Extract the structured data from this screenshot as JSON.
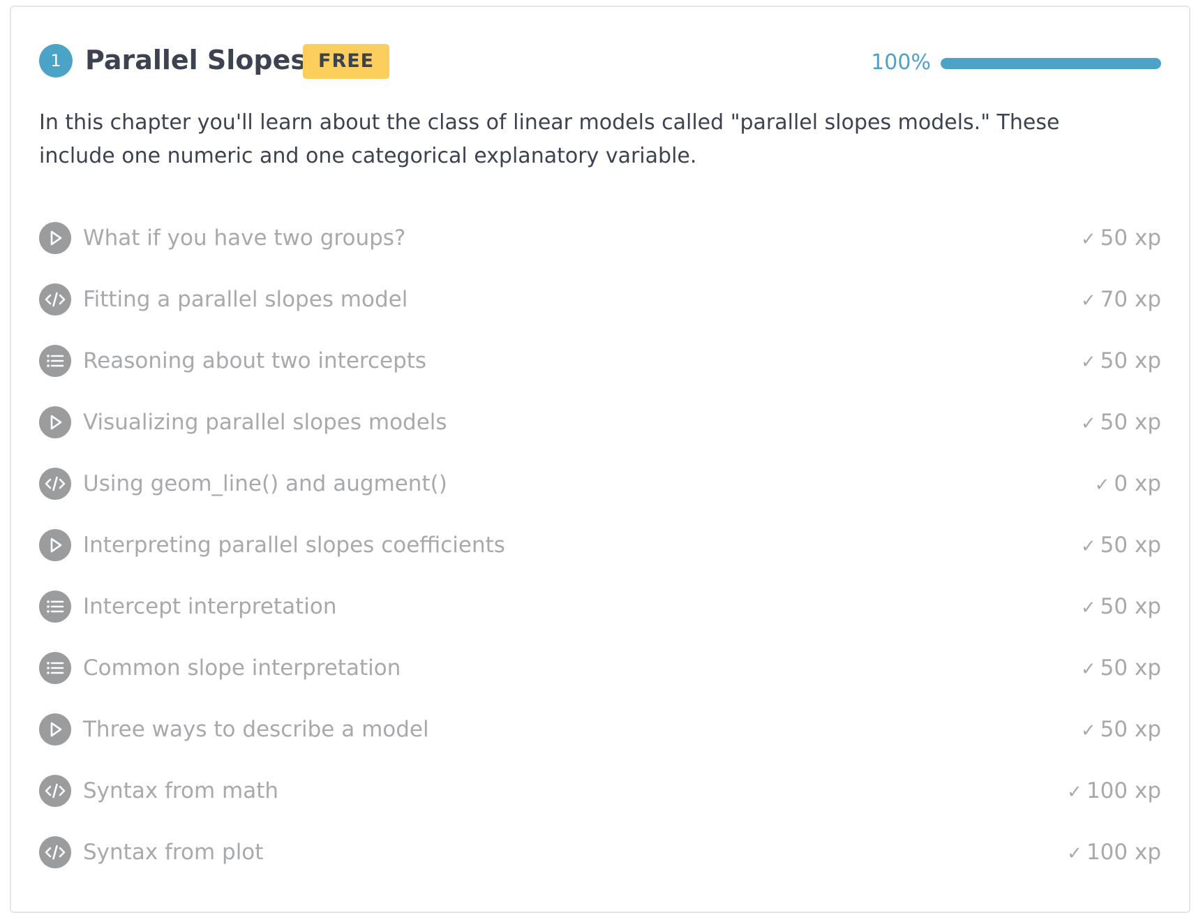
{
  "chapter": {
    "number": "1",
    "title": "Parallel Slopes",
    "badge": "FREE",
    "progress_label": "100%",
    "progress_fraction": 1.0,
    "description": "In this chapter you'll learn about the class of linear models called \"parallel slopes models.\" These include one numeric and one categorical explanatory variable."
  },
  "lessons": [
    {
      "icon": "play-icon",
      "title": "What if you have two groups?",
      "xp": "50 xp"
    },
    {
      "icon": "code-icon",
      "title": "Fitting a parallel slopes model",
      "xp": "70 xp"
    },
    {
      "icon": "list-icon",
      "title": "Reasoning about two intercepts",
      "xp": "50 xp"
    },
    {
      "icon": "play-icon",
      "title": "Visualizing parallel slopes models",
      "xp": "50 xp"
    },
    {
      "icon": "code-icon",
      "title": "Using geom_line() and augment()",
      "xp": "0 xp"
    },
    {
      "icon": "play-icon",
      "title": "Interpreting parallel slopes coefficients",
      "xp": "50 xp"
    },
    {
      "icon": "list-icon",
      "title": "Intercept interpretation",
      "xp": "50 xp"
    },
    {
      "icon": "list-icon",
      "title": "Common slope interpretation",
      "xp": "50 xp"
    },
    {
      "icon": "play-icon",
      "title": "Three ways to describe a model",
      "xp": "50 xp"
    },
    {
      "icon": "code-icon",
      "title": "Syntax from math",
      "xp": "100 xp"
    },
    {
      "icon": "code-icon",
      "title": "Syntax from plot",
      "xp": "100 xp"
    }
  ],
  "check_glyph": "✓",
  "colors": {
    "accent": "#4ba3c7",
    "badge": "#fcce5b",
    "icon_bg": "#9b9c9e",
    "completed_text": "#a7a9ad",
    "title_text": "#3d4251"
  }
}
